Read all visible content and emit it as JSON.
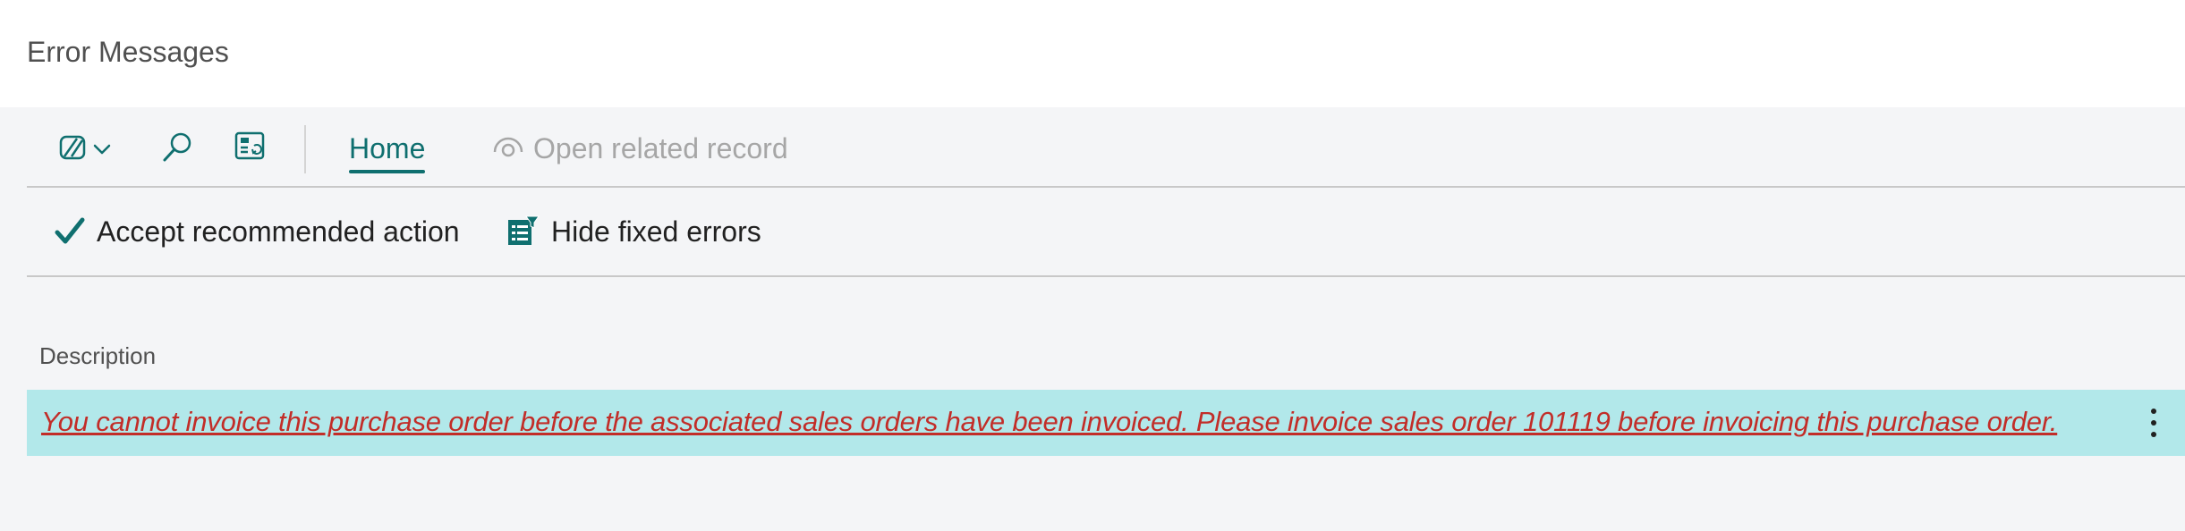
{
  "page": {
    "title": "Error Messages"
  },
  "action_bar": {
    "copilot_icon": "copilot-icon",
    "search_icon": "search-icon",
    "layout_icon": "layout-icon",
    "home_tab": "Home",
    "open_related_label": "Open related record",
    "open_related_icon": "eye-icon"
  },
  "actions": {
    "accept_label": "Accept recommended action",
    "accept_icon": "checkmark-icon",
    "hide_label": "Hide fixed errors",
    "hide_icon": "filter-list-icon"
  },
  "list": {
    "column_header": "Description",
    "rows": [
      {
        "description": "You cannot invoice this purchase order before the associated sales orders have been invoiced. Please invoice sales order 101119 before invoicing this purchase order."
      }
    ],
    "row_menu_icon": "more-vertical-icon"
  },
  "colors": {
    "accent": "#0f6f6f",
    "selected_row": "#b2e8ea",
    "error_text": "#c22d28",
    "disabled_text": "#a6a6a6"
  }
}
